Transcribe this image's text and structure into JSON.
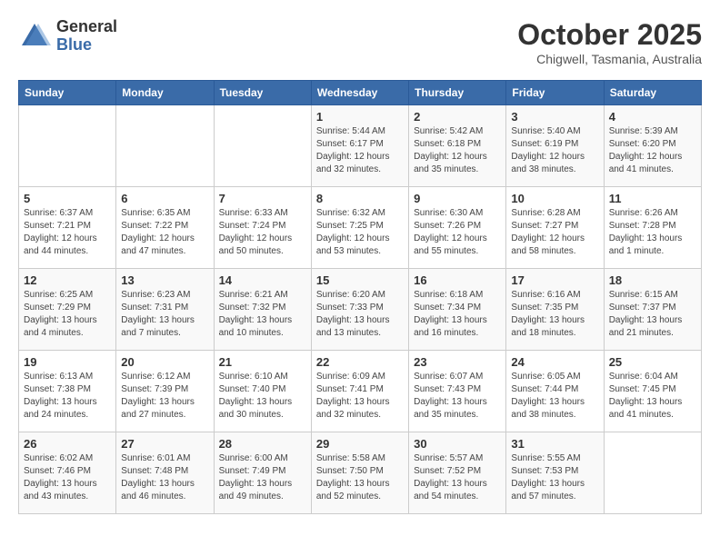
{
  "header": {
    "logo_line1": "General",
    "logo_line2": "Blue",
    "month": "October 2025",
    "location": "Chigwell, Tasmania, Australia"
  },
  "weekdays": [
    "Sunday",
    "Monday",
    "Tuesday",
    "Wednesday",
    "Thursday",
    "Friday",
    "Saturday"
  ],
  "weeks": [
    [
      {
        "day": "",
        "info": ""
      },
      {
        "day": "",
        "info": ""
      },
      {
        "day": "",
        "info": ""
      },
      {
        "day": "1",
        "info": "Sunrise: 5:44 AM\nSunset: 6:17 PM\nDaylight: 12 hours\nand 32 minutes."
      },
      {
        "day": "2",
        "info": "Sunrise: 5:42 AM\nSunset: 6:18 PM\nDaylight: 12 hours\nand 35 minutes."
      },
      {
        "day": "3",
        "info": "Sunrise: 5:40 AM\nSunset: 6:19 PM\nDaylight: 12 hours\nand 38 minutes."
      },
      {
        "day": "4",
        "info": "Sunrise: 5:39 AM\nSunset: 6:20 PM\nDaylight: 12 hours\nand 41 minutes."
      }
    ],
    [
      {
        "day": "5",
        "info": "Sunrise: 6:37 AM\nSunset: 7:21 PM\nDaylight: 12 hours\nand 44 minutes."
      },
      {
        "day": "6",
        "info": "Sunrise: 6:35 AM\nSunset: 7:22 PM\nDaylight: 12 hours\nand 47 minutes."
      },
      {
        "day": "7",
        "info": "Sunrise: 6:33 AM\nSunset: 7:24 PM\nDaylight: 12 hours\nand 50 minutes."
      },
      {
        "day": "8",
        "info": "Sunrise: 6:32 AM\nSunset: 7:25 PM\nDaylight: 12 hours\nand 53 minutes."
      },
      {
        "day": "9",
        "info": "Sunrise: 6:30 AM\nSunset: 7:26 PM\nDaylight: 12 hours\nand 55 minutes."
      },
      {
        "day": "10",
        "info": "Sunrise: 6:28 AM\nSunset: 7:27 PM\nDaylight: 12 hours\nand 58 minutes."
      },
      {
        "day": "11",
        "info": "Sunrise: 6:26 AM\nSunset: 7:28 PM\nDaylight: 13 hours\nand 1 minute."
      }
    ],
    [
      {
        "day": "12",
        "info": "Sunrise: 6:25 AM\nSunset: 7:29 PM\nDaylight: 13 hours\nand 4 minutes."
      },
      {
        "day": "13",
        "info": "Sunrise: 6:23 AM\nSunset: 7:31 PM\nDaylight: 13 hours\nand 7 minutes."
      },
      {
        "day": "14",
        "info": "Sunrise: 6:21 AM\nSunset: 7:32 PM\nDaylight: 13 hours\nand 10 minutes."
      },
      {
        "day": "15",
        "info": "Sunrise: 6:20 AM\nSunset: 7:33 PM\nDaylight: 13 hours\nand 13 minutes."
      },
      {
        "day": "16",
        "info": "Sunrise: 6:18 AM\nSunset: 7:34 PM\nDaylight: 13 hours\nand 16 minutes."
      },
      {
        "day": "17",
        "info": "Sunrise: 6:16 AM\nSunset: 7:35 PM\nDaylight: 13 hours\nand 18 minutes."
      },
      {
        "day": "18",
        "info": "Sunrise: 6:15 AM\nSunset: 7:37 PM\nDaylight: 13 hours\nand 21 minutes."
      }
    ],
    [
      {
        "day": "19",
        "info": "Sunrise: 6:13 AM\nSunset: 7:38 PM\nDaylight: 13 hours\nand 24 minutes."
      },
      {
        "day": "20",
        "info": "Sunrise: 6:12 AM\nSunset: 7:39 PM\nDaylight: 13 hours\nand 27 minutes."
      },
      {
        "day": "21",
        "info": "Sunrise: 6:10 AM\nSunset: 7:40 PM\nDaylight: 13 hours\nand 30 minutes."
      },
      {
        "day": "22",
        "info": "Sunrise: 6:09 AM\nSunset: 7:41 PM\nDaylight: 13 hours\nand 32 minutes."
      },
      {
        "day": "23",
        "info": "Sunrise: 6:07 AM\nSunset: 7:43 PM\nDaylight: 13 hours\nand 35 minutes."
      },
      {
        "day": "24",
        "info": "Sunrise: 6:05 AM\nSunset: 7:44 PM\nDaylight: 13 hours\nand 38 minutes."
      },
      {
        "day": "25",
        "info": "Sunrise: 6:04 AM\nSunset: 7:45 PM\nDaylight: 13 hours\nand 41 minutes."
      }
    ],
    [
      {
        "day": "26",
        "info": "Sunrise: 6:02 AM\nSunset: 7:46 PM\nDaylight: 13 hours\nand 43 minutes."
      },
      {
        "day": "27",
        "info": "Sunrise: 6:01 AM\nSunset: 7:48 PM\nDaylight: 13 hours\nand 46 minutes."
      },
      {
        "day": "28",
        "info": "Sunrise: 6:00 AM\nSunset: 7:49 PM\nDaylight: 13 hours\nand 49 minutes."
      },
      {
        "day": "29",
        "info": "Sunrise: 5:58 AM\nSunset: 7:50 PM\nDaylight: 13 hours\nand 52 minutes."
      },
      {
        "day": "30",
        "info": "Sunrise: 5:57 AM\nSunset: 7:52 PM\nDaylight: 13 hours\nand 54 minutes."
      },
      {
        "day": "31",
        "info": "Sunrise: 5:55 AM\nSunset: 7:53 PM\nDaylight: 13 hours\nand 57 minutes."
      },
      {
        "day": "",
        "info": ""
      }
    ]
  ]
}
